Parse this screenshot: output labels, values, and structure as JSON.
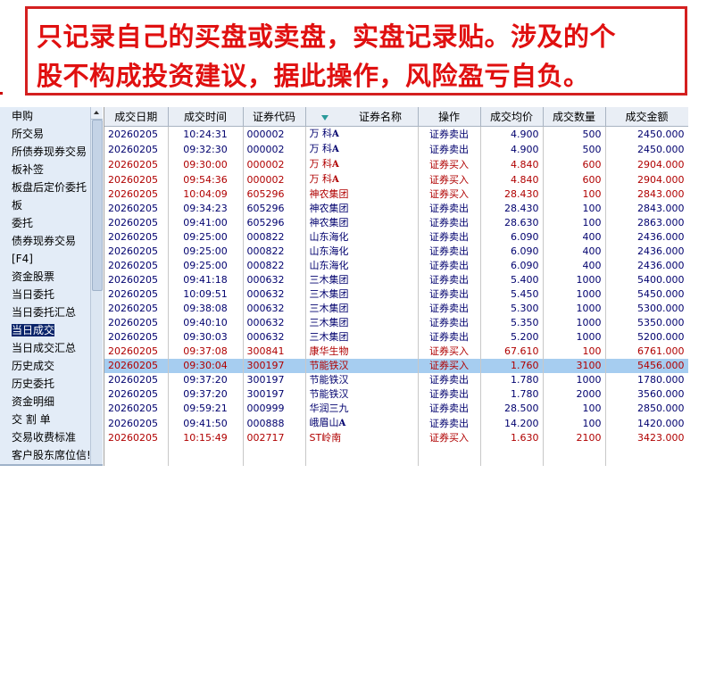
{
  "banner": {
    "line1": "只记录自己的买盘或卖盘，实盘记录贴。涉及的个",
    "line2": "股不构成投资建议，据此操作，风险盈亏自负。"
  },
  "sidebar": {
    "items": [
      {
        "label": "申购",
        "selected": false
      },
      {
        "label": "所交易",
        "selected": false
      },
      {
        "label": "所债券现券交易",
        "selected": false
      },
      {
        "label": "板补签",
        "selected": false
      },
      {
        "label": "板盘后定价委托",
        "selected": false
      },
      {
        "label": "板",
        "selected": false
      },
      {
        "label": "委托",
        "selected": false
      },
      {
        "label": "债券现券交易",
        "selected": false
      },
      {
        "label": "[F4]",
        "selected": false
      },
      {
        "label": "资金股票",
        "selected": false
      },
      {
        "label": "当日委托",
        "selected": false
      },
      {
        "label": "当日委托汇总",
        "selected": false
      },
      {
        "label": "当日成交",
        "selected": true
      },
      {
        "label": "当日成交汇总",
        "selected": false
      },
      {
        "label": "历史成交",
        "selected": false
      },
      {
        "label": "历史委托",
        "selected": false
      },
      {
        "label": "资金明细",
        "selected": false
      },
      {
        "label": "交 割 单",
        "selected": false
      },
      {
        "label": "交易收费标准",
        "selected": false
      },
      {
        "label": "客户股东席位信!",
        "selected": false
      }
    ]
  },
  "table": {
    "columns": [
      "成交日期",
      "成交时间",
      "证券代码",
      "证券名称",
      "操作",
      "成交均价",
      "成交数量",
      "成交金额"
    ],
    "rows": [
      {
        "date": "20260205",
        "time": "10:24:31",
        "code": "000002",
        "name": "万  科",
        "mark": "A",
        "op": "证券卖出",
        "price": "4.900",
        "qty": "500",
        "amount": "2450.000",
        "side": "sell"
      },
      {
        "date": "20260205",
        "time": "09:32:30",
        "code": "000002",
        "name": "万  科",
        "mark": "A",
        "op": "证券卖出",
        "price": "4.900",
        "qty": "500",
        "amount": "2450.000",
        "side": "sell"
      },
      {
        "date": "20260205",
        "time": "09:30:00",
        "code": "000002",
        "name": "万  科",
        "mark": "A",
        "op": "证券买入",
        "price": "4.840",
        "qty": "600",
        "amount": "2904.000",
        "side": "buy"
      },
      {
        "date": "20260205",
        "time": "09:54:36",
        "code": "000002",
        "name": "万  科",
        "mark": "A",
        "op": "证券买入",
        "price": "4.840",
        "qty": "600",
        "amount": "2904.000",
        "side": "buy"
      },
      {
        "date": "20260205",
        "time": "10:04:09",
        "code": "605296",
        "name": "神农集团",
        "mark": "",
        "op": "证券买入",
        "price": "28.430",
        "qty": "100",
        "amount": "2843.000",
        "side": "buy"
      },
      {
        "date": "20260205",
        "time": "09:34:23",
        "code": "605296",
        "name": "神农集团",
        "mark": "",
        "op": "证券卖出",
        "price": "28.430",
        "qty": "100",
        "amount": "2843.000",
        "side": "sell"
      },
      {
        "date": "20260205",
        "time": "09:41:00",
        "code": "605296",
        "name": "神农集团",
        "mark": "",
        "op": "证券卖出",
        "price": "28.630",
        "qty": "100",
        "amount": "2863.000",
        "side": "sell"
      },
      {
        "date": "20260205",
        "time": "09:25:00",
        "code": "000822",
        "name": "山东海化",
        "mark": "",
        "op": "证券卖出",
        "price": "6.090",
        "qty": "400",
        "amount": "2436.000",
        "side": "sell"
      },
      {
        "date": "20260205",
        "time": "09:25:00",
        "code": "000822",
        "name": "山东海化",
        "mark": "",
        "op": "证券卖出",
        "price": "6.090",
        "qty": "400",
        "amount": "2436.000",
        "side": "sell"
      },
      {
        "date": "20260205",
        "time": "09:25:00",
        "code": "000822",
        "name": "山东海化",
        "mark": "",
        "op": "证券卖出",
        "price": "6.090",
        "qty": "400",
        "amount": "2436.000",
        "side": "sell"
      },
      {
        "date": "20260205",
        "time": "09:41:18",
        "code": "000632",
        "name": "三木集团",
        "mark": "",
        "op": "证券卖出",
        "price": "5.400",
        "qty": "1000",
        "amount": "5400.000",
        "side": "sell"
      },
      {
        "date": "20260205",
        "time": "10:09:51",
        "code": "000632",
        "name": "三木集团",
        "mark": "",
        "op": "证券卖出",
        "price": "5.450",
        "qty": "1000",
        "amount": "5450.000",
        "side": "sell"
      },
      {
        "date": "20260205",
        "time": "09:38:08",
        "code": "000632",
        "name": "三木集团",
        "mark": "",
        "op": "证券卖出",
        "price": "5.300",
        "qty": "1000",
        "amount": "5300.000",
        "side": "sell"
      },
      {
        "date": "20260205",
        "time": "09:40:10",
        "code": "000632",
        "name": "三木集团",
        "mark": "",
        "op": "证券卖出",
        "price": "5.350",
        "qty": "1000",
        "amount": "5350.000",
        "side": "sell"
      },
      {
        "date": "20260205",
        "time": "09:30:03",
        "code": "000632",
        "name": "三木集团",
        "mark": "",
        "op": "证券卖出",
        "price": "5.200",
        "qty": "1000",
        "amount": "5200.000",
        "side": "sell"
      },
      {
        "date": "20260205",
        "time": "09:37:08",
        "code": "300841",
        "name": "康华生物",
        "mark": "",
        "op": "证券买入",
        "price": "67.610",
        "qty": "100",
        "amount": "6761.000",
        "side": "buy"
      },
      {
        "date": "20260205",
        "time": "09:30:04",
        "code": "300197",
        "name": "节能铁汉",
        "mark": "",
        "op": "证券买入",
        "price": "1.760",
        "qty": "3100",
        "amount": "5456.000",
        "side": "buy",
        "selected": true
      },
      {
        "date": "20260205",
        "time": "09:37:20",
        "code": "300197",
        "name": "节能铁汉",
        "mark": "",
        "op": "证券卖出",
        "price": "1.780",
        "qty": "1000",
        "amount": "1780.000",
        "side": "sell"
      },
      {
        "date": "20260205",
        "time": "09:37:20",
        "code": "300197",
        "name": "节能铁汉",
        "mark": "",
        "op": "证券卖出",
        "price": "1.780",
        "qty": "2000",
        "amount": "3560.000",
        "side": "sell"
      },
      {
        "date": "20260205",
        "time": "09:59:21",
        "code": "000999",
        "name": "华润三九",
        "mark": "",
        "op": "证券卖出",
        "price": "28.500",
        "qty": "100",
        "amount": "2850.000",
        "side": "sell"
      },
      {
        "date": "20260205",
        "time": "09:41:50",
        "code": "000888",
        "name": "峨眉山",
        "mark": "A",
        "op": "证券卖出",
        "price": "14.200",
        "qty": "100",
        "amount": "1420.000",
        "side": "sell"
      },
      {
        "date": "20260205",
        "time": "10:15:49",
        "code": "002717",
        "name": "ST岭南",
        "mark": "",
        "op": "证券买入",
        "price": "1.630",
        "qty": "2100",
        "amount": "3423.000",
        "side": "buy"
      }
    ]
  },
  "colors": {
    "banner_text": "#e01010",
    "buy_text": "#b00000",
    "sell_text": "#00006e",
    "selected_row": "#a6cdf0",
    "sidebar_bg": "#e3ecf7"
  },
  "icons": {
    "sort": "sort-desc-triangle-icon",
    "scroll_up": "scroll-up-arrow-icon"
  }
}
